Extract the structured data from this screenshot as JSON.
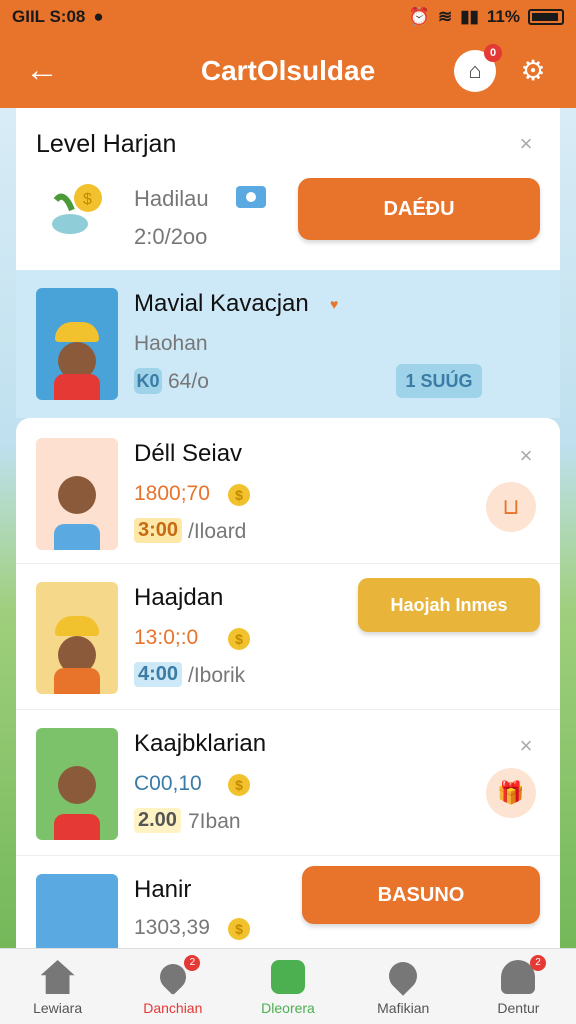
{
  "status_bar": {
    "left_text": "GIIL S:08",
    "battery_text": "11%"
  },
  "app_bar": {
    "title": "CartOlsuldae",
    "cart_badge": "0"
  },
  "top_card": {
    "title": "Level Harjan",
    "subtitle": "Hadilau",
    "time": "2:0/2oo",
    "button_label": "DAÉÐU"
  },
  "highlight_item": {
    "name": "Mavial Kavacjan",
    "sub": "Haohan",
    "badge": "K0",
    "stat": "64/o",
    "pill": "1 SUÚG"
  },
  "list": [
    {
      "name": "Déll Seiav",
      "price": "1800;70",
      "tag": "3:00",
      "tag_suffix": "/Iloard",
      "action": "icon"
    },
    {
      "name": "Haajdan",
      "price": "13:0;:0",
      "tag": "4:00",
      "tag_suffix": "/Iborik",
      "action_label": "Haojah Inmes"
    },
    {
      "name": "Kaajbklarian",
      "price": "C00,10",
      "tag": "2.00",
      "tag_suffix": "7Iban",
      "action": "icon"
    },
    {
      "name": "Hanir",
      "price": "1303,39",
      "action_label": "BASUNO"
    }
  ],
  "nav": [
    {
      "label": "Lewiara",
      "icon": "home-icon"
    },
    {
      "label": "Danchian",
      "icon": "heart-icon",
      "badge": "2"
    },
    {
      "label": "Dleorera",
      "icon": "check-icon"
    },
    {
      "label": "Mafikian",
      "icon": "location-icon"
    },
    {
      "label": "Dentur",
      "icon": "profile-icon",
      "badge": "2"
    }
  ]
}
